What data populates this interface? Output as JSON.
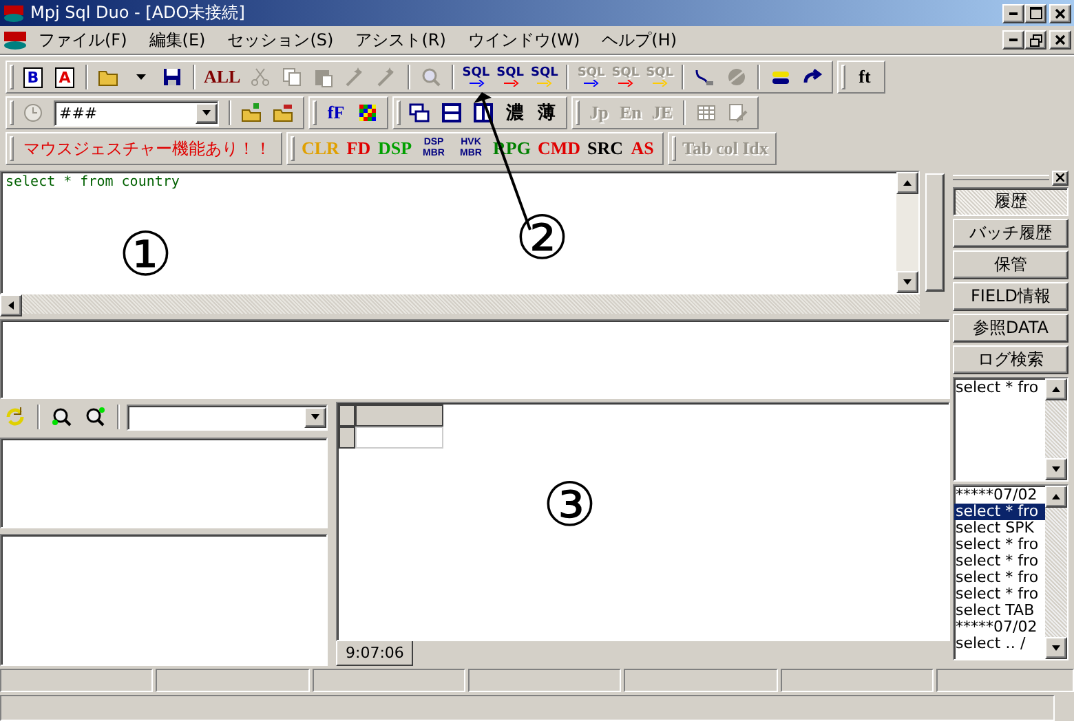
{
  "window": {
    "title": "Mpj Sql Duo - [ADO未接続]"
  },
  "menu": [
    {
      "label": "ファイル(F)"
    },
    {
      "label": "編集(E)"
    },
    {
      "label": "セッション(S)"
    },
    {
      "label": "アシスト(R)"
    },
    {
      "label": "ウインドウ(W)"
    },
    {
      "label": "ヘルプ(H)"
    }
  ],
  "toolbars": [
    [
      [
        {
          "kind": "doc",
          "label": "B",
          "color": "#0000c0",
          "disabled": false
        },
        {
          "kind": "doc",
          "label": "A",
          "color": "#e00000",
          "disabled": false
        },
        {
          "kind": "sep"
        },
        {
          "kind": "folder-open",
          "disabled": false
        },
        {
          "kind": "caret",
          "disabled": false
        },
        {
          "kind": "save",
          "disabled": false
        },
        {
          "kind": "sep"
        },
        {
          "kind": "text",
          "label": "ALL",
          "color": "#800000",
          "disabled": false
        },
        {
          "kind": "scissors",
          "disabled": true
        },
        {
          "kind": "copy",
          "disabled": true
        },
        {
          "kind": "paste",
          "disabled": true
        },
        {
          "kind": "wizard",
          "disabled": true
        },
        {
          "kind": "wizard",
          "disabled": true
        },
        {
          "kind": "sep"
        },
        {
          "kind": "search",
          "disabled": true
        },
        {
          "kind": "sep"
        },
        {
          "kind": "sql",
          "label": "SQL",
          "color": "#0000ff",
          "disabled": false
        },
        {
          "kind": "sql",
          "label": "SQL",
          "color": "#ff0000",
          "disabled": false
        },
        {
          "kind": "sql",
          "label": "SQL",
          "color": "#ffcc00",
          "disabled": false
        },
        {
          "kind": "sep"
        },
        {
          "kind": "sql",
          "label": "SQL",
          "color": "#0000ff",
          "disabled": true
        },
        {
          "kind": "sql",
          "label": "SQL",
          "color": "#ff0000",
          "disabled": true
        },
        {
          "kind": "sql",
          "label": "SQL",
          "color": "#ffcc00",
          "disabled": true
        },
        {
          "kind": "sep"
        },
        {
          "kind": "plug",
          "disabled": false
        },
        {
          "kind": "globe",
          "disabled": true
        },
        {
          "kind": "sep"
        },
        {
          "kind": "swap",
          "disabled": false
        },
        {
          "kind": "redo",
          "disabled": false
        }
      ],
      [
        {
          "kind": "text",
          "label": "ft",
          "color": "#000000",
          "disabled": false
        }
      ]
    ],
    [
      [
        {
          "kind": "clock",
          "disabled": true
        },
        {
          "kind": "combo",
          "value": "###"
        },
        {
          "kind": "sep"
        },
        {
          "kind": "folder-add",
          "disabled": false
        },
        {
          "kind": "folder-remove",
          "disabled": false
        }
      ],
      [
        {
          "kind": "text",
          "label": "fF",
          "color": "#0000c0",
          "disabled": false
        },
        {
          "kind": "grid",
          "disabled": false
        }
      ],
      [
        {
          "kind": "cascade",
          "disabled": false
        },
        {
          "kind": "tile-h",
          "disabled": false
        },
        {
          "kind": "tile-v",
          "disabled": false
        },
        {
          "kind": "text",
          "label": "濃",
          "color": "#000000",
          "disabled": false
        },
        {
          "kind": "text",
          "label": "薄",
          "color": "#000000",
          "disabled": false
        }
      ],
      [
        {
          "kind": "text",
          "label": "Jp",
          "disabled": true
        },
        {
          "kind": "text",
          "label": "En",
          "disabled": true
        },
        {
          "kind": "text",
          "label": "JE",
          "disabled": true
        },
        {
          "kind": "sep"
        },
        {
          "kind": "table",
          "disabled": true
        },
        {
          "kind": "edit",
          "disabled": true
        }
      ]
    ],
    [
      [
        {
          "kind": "notice",
          "label": "マウスジェスチャー機能あり！！"
        }
      ],
      [
        {
          "kind": "text",
          "label": "CLR",
          "color": "#e0a000",
          "disabled": false
        },
        {
          "kind": "text",
          "label": "FD",
          "color": "#e00000",
          "disabled": false
        },
        {
          "kind": "text",
          "label": "DSP",
          "color": "#00a000",
          "disabled": false
        },
        {
          "kind": "small",
          "label": "DSP MBR",
          "color": "#000080",
          "disabled": false
        },
        {
          "kind": "small",
          "label": "HVK MBR",
          "color": "#000080",
          "disabled": false
        },
        {
          "kind": "text",
          "label": "RPG",
          "color": "#008000",
          "disabled": false
        },
        {
          "kind": "text",
          "label": "CMD",
          "color": "#e00000",
          "disabled": false
        },
        {
          "kind": "text",
          "label": "SRC",
          "color": "#000000",
          "disabled": false
        },
        {
          "kind": "text",
          "label": "AS",
          "color": "#e00000",
          "disabled": false
        }
      ],
      [
        {
          "kind": "text",
          "label": "Tab col Idx",
          "disabled": true
        }
      ]
    ]
  ],
  "editor": {
    "text": "select * from country"
  },
  "side_panel": {
    "buttons": [
      {
        "label": "履歴",
        "selected": true
      },
      {
        "label": "バッチ履歴",
        "selected": false
      },
      {
        "label": "保管",
        "selected": false
      },
      {
        "label": "FIELD情報",
        "selected": false
      },
      {
        "label": "参照DATA",
        "selected": false
      },
      {
        "label": "ログ検索",
        "selected": false
      }
    ],
    "preview": "select * fro",
    "history": [
      {
        "text": "*****07/02",
        "selected": false
      },
      {
        "text": "select * fro",
        "selected": true
      },
      {
        "text": "select SPK",
        "selected": false
      },
      {
        "text": "select * fro",
        "selected": false
      },
      {
        "text": "select * fro",
        "selected": false
      },
      {
        "text": "select * fro",
        "selected": false
      },
      {
        "text": "select * fro",
        "selected": false
      },
      {
        "text": "select TAB",
        "selected": false
      },
      {
        "text": "*****07/02",
        "selected": false
      },
      {
        "text": "select ‥ /",
        "selected": false
      }
    ]
  },
  "result_tabs": [
    {
      "label": "9:07:06",
      "selected": true
    }
  ],
  "annotations": [
    {
      "label": "①"
    },
    {
      "label": "②"
    },
    {
      "label": "③"
    }
  ]
}
